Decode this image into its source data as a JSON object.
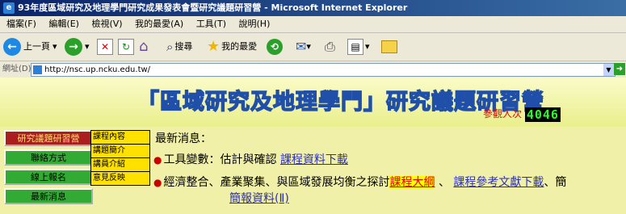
{
  "window": {
    "title": "93年度區域研究及地理學門研究成果發表會暨研究議題研習營 - Microsoft Internet Explorer"
  },
  "menu": [
    "檔案(F)",
    "編輯(E)",
    "檢視(V)",
    "我的最愛(A)",
    "工具(T)",
    "說明(H)"
  ],
  "toolbar": {
    "back_label": "上一頁",
    "search_label": "搜尋",
    "favorites_label": "我的最愛"
  },
  "address": {
    "label": "網址(D)",
    "url": "http://nsc.up.ncku.edu.tw/"
  },
  "banner": {
    "title": "「區域研究及地理學門」研究議題研習營",
    "visitors_label": "參觀人次",
    "visitors_count": "4046"
  },
  "nav": {
    "items": [
      {
        "label": "研究議題研習營"
      },
      {
        "label": "聯絡方式"
      },
      {
        "label": "線上報名"
      },
      {
        "label": "最新消息"
      }
    ],
    "submenu": [
      "課程內容",
      "講題簡介",
      "講員介紹",
      "意見反映"
    ]
  },
  "news": {
    "heading": "最新消息：",
    "item1_text": "工具變數：估計與確認",
    "item1_link": "課程資料下載",
    "item2_text": "經濟整合、產業聚集、與區域發展均衡之探討",
    "item2_link1": "課程大綱",
    "item2_sep1": "、",
    "item2_link2": "課程參考文獻下載",
    "item2_sep2": "、",
    "item2_tail": "簡",
    "item2_link3": "簡報資料(Ⅱ)"
  }
}
